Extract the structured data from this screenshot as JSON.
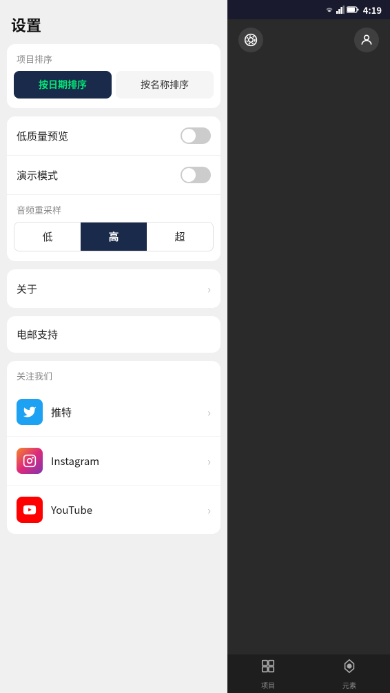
{
  "statusBar": {
    "time": "4:19"
  },
  "settings": {
    "title": "设置",
    "sortSection": {
      "label": "项目排序",
      "byDate": "按日期排序",
      "byName": "按名称排序",
      "activeIndex": 0
    },
    "toggleSection": {
      "lowQualityPreview": {
        "label": "低质量预览",
        "on": false
      },
      "demoMode": {
        "label": "演示模式",
        "on": false
      }
    },
    "audioResample": {
      "label": "音频重采样",
      "options": [
        "低",
        "高",
        "超"
      ],
      "activeIndex": 1
    },
    "about": {
      "label": "关于"
    },
    "emailSupport": {
      "label": "电邮支持"
    },
    "followUs": {
      "label": "关注我们",
      "items": [
        {
          "name": "twitter",
          "label": "推特",
          "icon": "twitter"
        },
        {
          "name": "instagram",
          "label": "Instagram",
          "icon": "instagram"
        },
        {
          "name": "youtube",
          "label": "YouTube",
          "icon": "youtube"
        }
      ]
    }
  },
  "bottomNav": {
    "items": [
      {
        "name": "项目",
        "icon": "⊞"
      },
      {
        "name": "元素",
        "icon": "◈"
      }
    ]
  }
}
